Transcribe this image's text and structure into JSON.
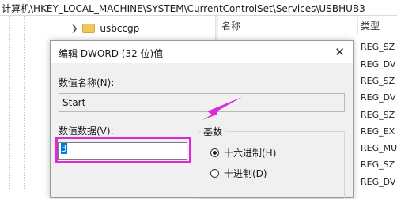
{
  "address_bar": {
    "path": "计算机\\HKEY_LOCAL_MACHINE\\SYSTEM\\CurrentControlSet\\Services\\USBHUB3"
  },
  "tree": {
    "items": [
      {
        "label": "usbccgp"
      }
    ]
  },
  "list": {
    "headers": {
      "name": "名称",
      "type": "类型"
    },
    "types": [
      "REG_SZ",
      "REG_DV",
      "REG_SZ",
      "REG_DV",
      "REG_SZ",
      "REG_EX",
      "REG_MU",
      "REG_SZ",
      "REG_DV"
    ]
  },
  "dialog": {
    "title": "编辑 DWORD (32 位)值",
    "name_label": "数值名称(N):",
    "name_value": "Start",
    "data_label": "数值数据(V):",
    "data_value": "3",
    "base_label": "基数",
    "base_options": [
      {
        "label": "十六进制(H)",
        "selected": true
      },
      {
        "label": "十进制(D)",
        "selected": false
      }
    ]
  },
  "colors": {
    "highlight": "#d82ad8",
    "accent": "#0078d7"
  }
}
